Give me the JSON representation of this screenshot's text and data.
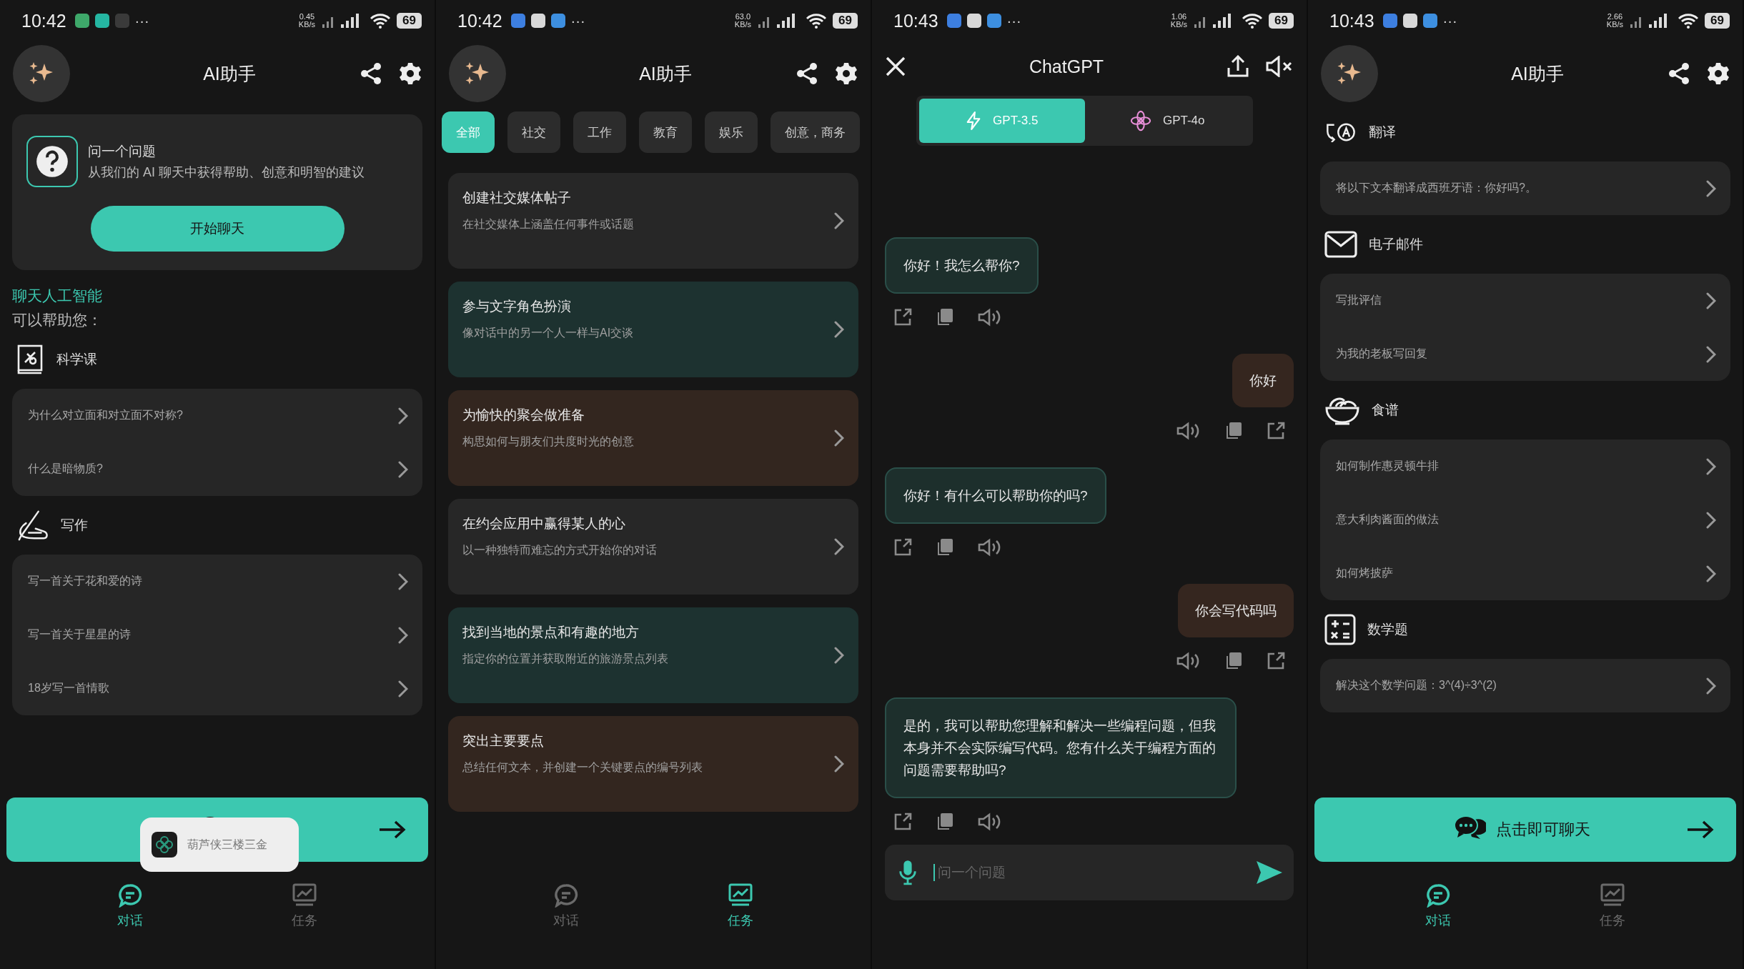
{
  "panels": [
    {
      "kind": "home",
      "status": {
        "time": "10:42",
        "notifications": [
          {
            "color": "#3ea86a"
          },
          {
            "color": "#25b6a2"
          },
          {
            "color": "#3a3a3a"
          }
        ],
        "more": "···",
        "speed": "0.45",
        "speed_unit": "KB/s",
        "battery": "69"
      },
      "title": "AI助手",
      "ask_card": {
        "title": "问一个问题",
        "subtitle": "从我们的 AI 聊天中获得帮助、创意和明智的建议",
        "button": "开始聊天"
      },
      "heading": "聊天人工智能",
      "subheading": "可以帮助您：",
      "categories": [
        {
          "kind": "science",
          "title": "科学课",
          "prompts": [
            "为什么对立面和对立面不对称?",
            "什么是暗物质?"
          ]
        },
        {
          "kind": "writing",
          "title": "写作",
          "prompts": [
            "写一首关于花和爱的诗",
            "写一首关于星星的诗",
            "18岁写一首情歌"
          ]
        }
      ],
      "toast": {
        "text": "葫芦侠三楼三金"
      },
      "nav": [
        {
          "label": "对话",
          "selected": true
        },
        {
          "label": "任务",
          "selected": false
        }
      ]
    },
    {
      "kind": "tasks",
      "status": {
        "time": "10:42",
        "notifications": [
          {
            "color": "#3d7fe0"
          },
          {
            "color": "#d8d8d8"
          },
          {
            "color": "#3d8fe0"
          }
        ],
        "more": "···",
        "speed": "63.0",
        "speed_unit": "KB/s",
        "battery": "69"
      },
      "title": "AI助手",
      "chips": [
        {
          "label": "全部",
          "selected": true
        },
        {
          "label": "社交",
          "selected": false
        },
        {
          "label": "工作",
          "selected": false
        },
        {
          "label": "教育",
          "selected": false
        },
        {
          "label": "娱乐",
          "selected": false
        },
        {
          "label": "创意，商务",
          "selected": false
        }
      ],
      "tasks": [
        {
          "title": "创建社交媒体帖子",
          "subtitle": "在社交媒体上涵盖任何事件或话题",
          "color": "#272727"
        },
        {
          "title": "参与文字角色扮演",
          "subtitle": "像对话中的另一个人一样与AI交谈",
          "color": "#1d3230"
        },
        {
          "title": "为愉快的聚会做准备",
          "subtitle": "构思如何与朋友们共度时光的创意",
          "color": "#33261f"
        },
        {
          "title": "在约会应用中赢得某人的心",
          "subtitle": "以一种独特而难忘的方式开始你的对话",
          "color": "#272727"
        },
        {
          "title": "找到当地的景点和有趣的地方",
          "subtitle": "指定你的位置并获取附近的旅游景点列表",
          "color": "#1d3230"
        },
        {
          "title": "突出主要要点",
          "subtitle": "总结任何文本，并创建一个关键要点的编号列表",
          "color": "#33261f"
        }
      ],
      "nav": [
        {
          "label": "对话",
          "selected": false
        },
        {
          "label": "任务",
          "selected": true
        }
      ]
    },
    {
      "kind": "chat",
      "status": {
        "time": "10:43",
        "notifications": [
          {
            "color": "#3d7fe0"
          },
          {
            "color": "#d8d8d8"
          },
          {
            "color": "#3d8fe0"
          }
        ],
        "more": "···",
        "speed": "1.06",
        "speed_unit": "KB/s",
        "battery": "69"
      },
      "title": "ChatGPT",
      "models": [
        {
          "label": "GPT-3.5",
          "selected": true
        },
        {
          "label": "GPT-4o",
          "selected": false
        }
      ],
      "messages": [
        {
          "kind": "bot",
          "text": "你好！我怎么帮你?"
        },
        {
          "kind": "user",
          "text": "你好"
        },
        {
          "kind": "bot",
          "text": "你好！有什么可以帮助你的吗?"
        },
        {
          "kind": "user",
          "text": "你会写代码吗"
        },
        {
          "kind": "bot",
          "text": "是的，我可以帮助您理解和解决一些编程问题，但我本身并不会实际编写代码。您有什么关于编程方面的问题需要帮助吗?"
        }
      ],
      "input": {
        "placeholder": "问一个问题"
      }
    },
    {
      "kind": "home",
      "status": {
        "time": "10:43",
        "notifications": [
          {
            "color": "#3d7fe0"
          },
          {
            "color": "#d8d8d8"
          },
          {
            "color": "#3d8fe0"
          }
        ],
        "more": "···",
        "speed": "2.66",
        "speed_unit": "KB/s",
        "battery": "69"
      },
      "title": "AI助手",
      "categories": [
        {
          "kind": "translation",
          "title": "翻译",
          "prompts": [
            "将以下文本翻译成西班牙语：你好吗?。"
          ]
        },
        {
          "kind": "email",
          "title": "电子邮件",
          "prompts": [
            "写批评信",
            "为我的老板写回复"
          ]
        },
        {
          "kind": "recipe",
          "title": "食谱",
          "prompts": [
            "如何制作惠灵顿牛排",
            "意大利肉酱面的做法",
            "如何烤披萨"
          ]
        },
        {
          "kind": "math",
          "title": "数学题",
          "prompts": [
            "解决这个数学问题：3^(4)÷3^(2)"
          ]
        }
      ],
      "chat_button": {
        "label": "点击即可聊天"
      },
      "nav": [
        {
          "label": "对话",
          "selected": true
        },
        {
          "label": "任务",
          "selected": false
        }
      ]
    }
  ]
}
